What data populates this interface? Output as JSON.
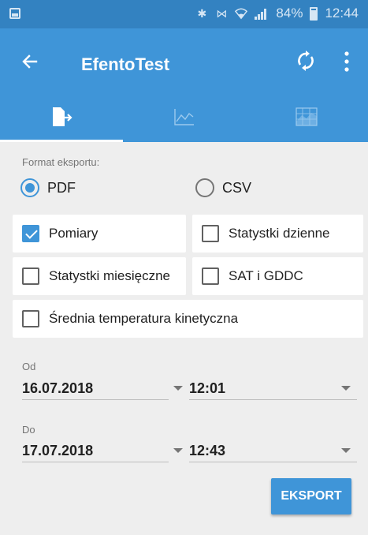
{
  "status_bar": {
    "battery": "84%",
    "time": "12:44",
    "icons": [
      "image-icon",
      "bluetooth-icon",
      "vibrate-icon",
      "wifi-icon",
      "signal-icon",
      "battery-icon"
    ]
  },
  "app_bar": {
    "title": "EfentoTest",
    "icons": [
      "back-arrow-icon",
      "sync-icon",
      "more-vert-icon"
    ]
  },
  "tabs": [
    {
      "icon": "export-file-icon",
      "active": true
    },
    {
      "icon": "line-chart-icon",
      "active": false
    },
    {
      "icon": "area-chart-icon",
      "active": false
    }
  ],
  "export_format": {
    "label": "Format eksportu:",
    "options": [
      {
        "label": "PDF",
        "selected": true
      },
      {
        "label": "CSV",
        "selected": false
      }
    ]
  },
  "checkboxes": [
    {
      "label": "Pomiary",
      "checked": true
    },
    {
      "label": "Statystki dzienne",
      "checked": false
    },
    {
      "label": "Statystki miesięczne",
      "checked": false
    },
    {
      "label": "SAT i GDDC",
      "checked": false
    },
    {
      "label": "Średnia temperatura kinetyczna",
      "checked": false
    }
  ],
  "from": {
    "label": "Od",
    "date": "16.07.2018",
    "time": "12:01"
  },
  "to": {
    "label": "Do",
    "date": "17.07.2018",
    "time": "12:43"
  },
  "export_button": "EKSPORT",
  "colors": {
    "primary": "#3f95d8",
    "status_bar": "#3382c1",
    "background": "#eeeeee"
  }
}
